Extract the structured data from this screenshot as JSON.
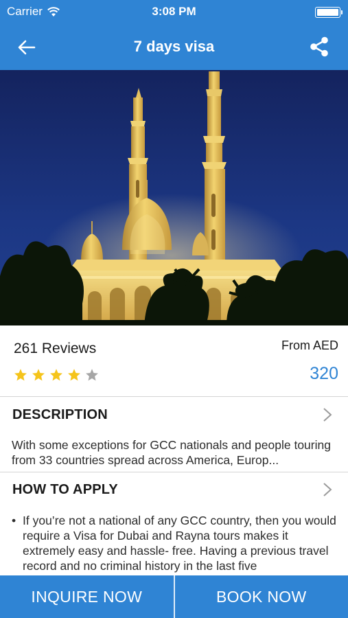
{
  "status_bar": {
    "carrier": "Carrier",
    "time": "3:08 PM",
    "wifi_icon": "wifi-icon",
    "battery_icon": "battery-icon"
  },
  "nav": {
    "title": "7 days visa",
    "back_icon": "back-arrow-icon",
    "share_icon": "share-icon"
  },
  "hero": {
    "image": "night view of an illuminated mosque with minarets and palm trees"
  },
  "info": {
    "reviews": "261 Reviews",
    "rating": 4,
    "rating_max": 5,
    "from_label": "From AED",
    "price": "320"
  },
  "description": {
    "heading": "DESCRIPTION",
    "text": "With some exceptions for GCC nationals and people touring from 33 countries spread across America, Europ..."
  },
  "how_to_apply": {
    "heading": "HOW TO APPLY",
    "bullet": "•",
    "text": "If you’re not a national of any GCC country, then you would require a Visa for Dubai and Rayna tours makes it extremely easy and hassle- free. Having a previous travel record and no criminal history in the last five"
  },
  "buttons": {
    "inquire": "INQUIRE NOW",
    "book": "BOOK NOW"
  },
  "colors": {
    "brand_blue": "#2f84d4",
    "star_filled": "#f5c41b",
    "star_empty": "#a6a6a6"
  }
}
